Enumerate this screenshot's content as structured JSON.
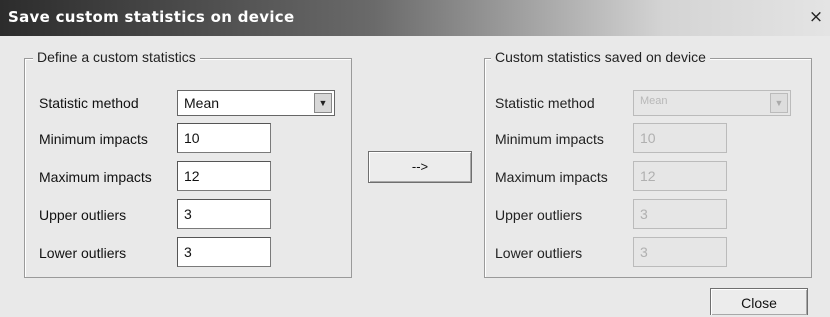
{
  "window": {
    "title": "Save custom statistics on device",
    "close_glyph": "×"
  },
  "left_group": {
    "legend": "Define a custom statistics",
    "statistic_method_label": "Statistic method",
    "statistic_method_value": "Mean",
    "minimum_impacts_label": "Minimum impacts",
    "minimum_impacts_value": "10",
    "maximum_impacts_label": "Maximum impacts",
    "maximum_impacts_value": "12",
    "upper_outliers_label": "Upper outliers",
    "upper_outliers_value": "3",
    "lower_outliers_label": "Lower outliers",
    "lower_outliers_value": "3"
  },
  "transfer_button_label": "-->",
  "right_group": {
    "legend": "Custom statistics saved on device",
    "statistic_method_label": "Statistic method",
    "statistic_method_value": "Mean",
    "minimum_impacts_label": "Minimum impacts",
    "minimum_impacts_value": "10",
    "maximum_impacts_label": "Maximum impacts",
    "maximum_impacts_value": "12",
    "upper_outliers_label": "Upper outliers",
    "upper_outliers_value": "3",
    "lower_outliers_label": "Lower outliers",
    "lower_outliers_value": "3"
  },
  "close_button_label": "Close",
  "icons": {
    "dropdown": "dropdown-arrow-icon",
    "window_close": "close-icon"
  }
}
